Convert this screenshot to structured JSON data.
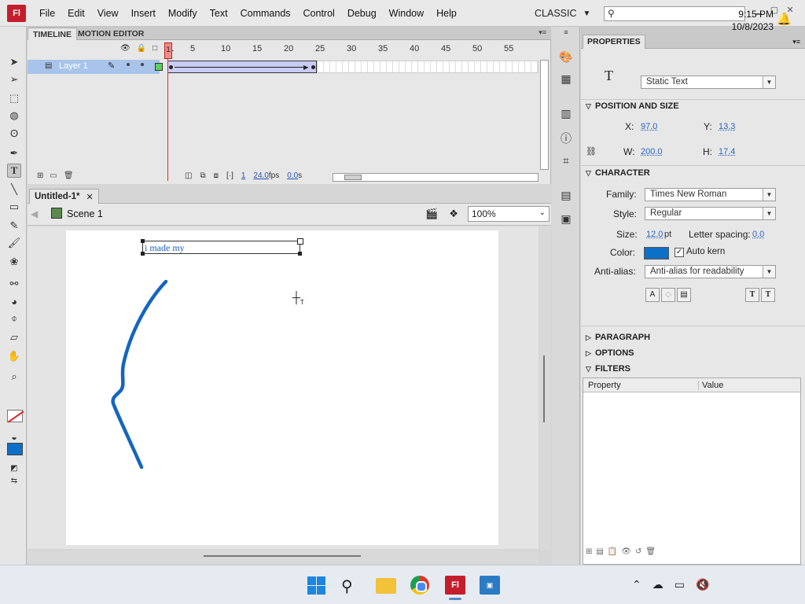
{
  "app": {
    "logo_text": "Fl",
    "menu": [
      "File",
      "Edit",
      "View",
      "Insert",
      "Modify",
      "Text",
      "Commands",
      "Control",
      "Debug",
      "Window",
      "Help"
    ],
    "workspace": "CLASSIC",
    "search_placeholder": ""
  },
  "tools": [
    {
      "name": "selection-tool-icon",
      "glyph": "➤"
    },
    {
      "name": "subselection-tool-icon",
      "glyph": "➢"
    },
    {
      "name": "free-transform-tool-icon",
      "glyph": "⬚"
    },
    {
      "name": "3d-rotation-tool-icon",
      "glyph": "◍"
    },
    {
      "name": "lasso-tool-icon",
      "glyph": "ʘ"
    },
    {
      "name": "pen-tool-icon",
      "glyph": "✒"
    },
    {
      "name": "text-tool-icon",
      "glyph": "T"
    },
    {
      "name": "line-tool-icon",
      "glyph": "╲"
    },
    {
      "name": "rectangle-tool-icon",
      "glyph": "▭"
    },
    {
      "name": "pencil-tool-icon",
      "glyph": "✎"
    },
    {
      "name": "brush-tool-icon",
      "glyph": "🖌"
    },
    {
      "name": "deco-tool-icon",
      "glyph": "❀"
    },
    {
      "name": "bone-tool-icon",
      "glyph": "⚯"
    },
    {
      "name": "paint-bucket-tool-icon",
      "glyph": "◕"
    },
    {
      "name": "eyedropper-tool-icon",
      "glyph": "⌽"
    },
    {
      "name": "eraser-tool-icon",
      "glyph": "▱"
    },
    {
      "name": "hand-tool-icon",
      "glyph": "✋"
    },
    {
      "name": "zoom-tool-icon",
      "glyph": "⌕"
    }
  ],
  "timeline": {
    "tabs": [
      "TIMELINE",
      "MOTION EDITOR"
    ],
    "ruler": [
      "1",
      "5",
      "10",
      "15",
      "20",
      "25",
      "30",
      "35",
      "40",
      "45",
      "50",
      "55"
    ],
    "layer_name": "Layer 1",
    "current_frame": "1",
    "fps": "24.0",
    "fps_unit": "fps",
    "time": "0.0",
    "time_unit": "s"
  },
  "document": {
    "tab_title": "Untitled-1*",
    "close_glyph": "✕",
    "scene": "Scene 1",
    "zoom": "100%",
    "text_content": "i made my",
    "stroke_color": "#1565c0"
  },
  "properties": {
    "tab": "PROPERTIES",
    "text_type": "Static Text",
    "sections": {
      "position_size": "POSITION AND SIZE",
      "character": "CHARACTER",
      "paragraph": "PARAGRAPH",
      "options": "OPTIONS",
      "filters": "FILTERS"
    },
    "x_label": "X:",
    "x": "97.0",
    "y_label": "Y:",
    "y": "13.3",
    "w_label": "W:",
    "w": "200.0",
    "h_label": "H:",
    "h": "17.4",
    "family_label": "Family:",
    "family": "Times New Roman",
    "style_label": "Style:",
    "style": "Regular",
    "size_label": "Size:",
    "size": "12.0",
    "size_unit": "pt",
    "spacing_label": "Letter spacing:",
    "spacing": "0.0",
    "color_label": "Color:",
    "text_color": "#0e6fc7",
    "autokern_label": "Auto kern",
    "autokern_checked": true,
    "antialias_label": "Anti-alias:",
    "antialias": "Anti-alias for readability",
    "filters_columns": [
      "Property",
      "Value"
    ]
  },
  "taskbar": {
    "time": "9:15 PM",
    "date": "10/8/2023"
  }
}
